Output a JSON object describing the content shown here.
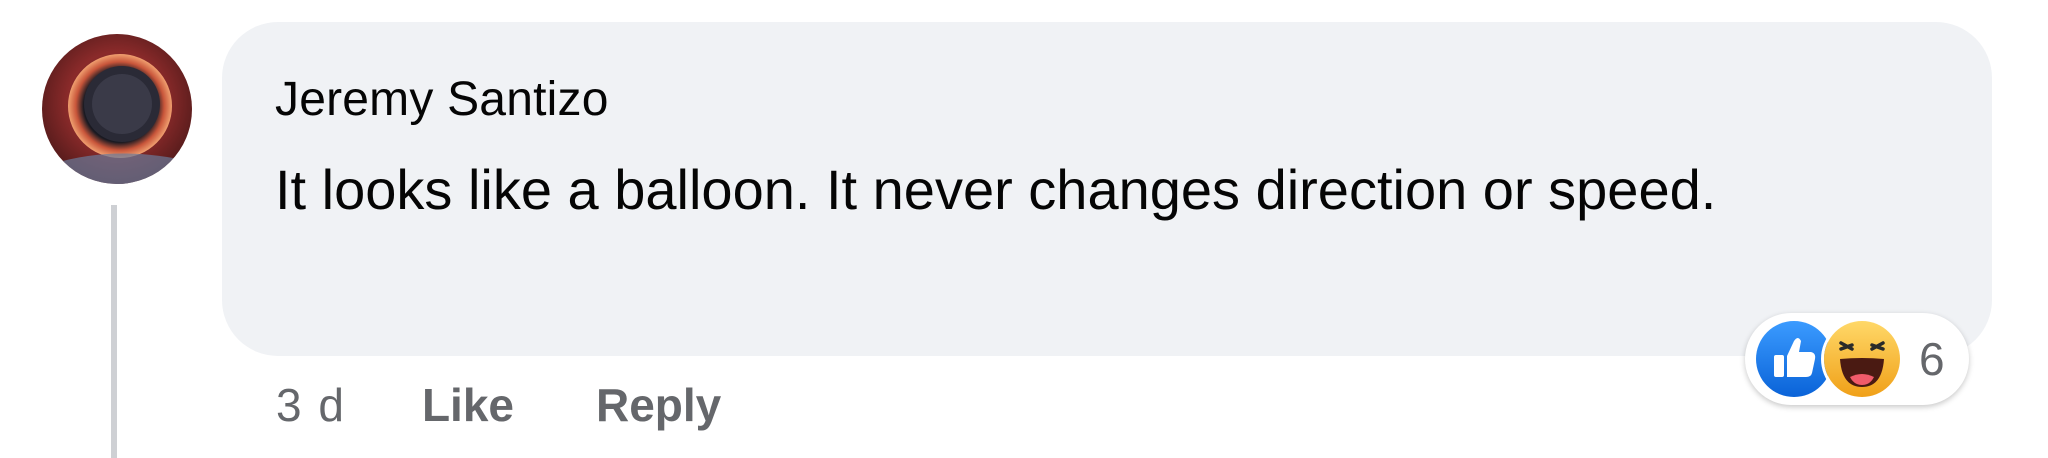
{
  "comment": {
    "author": "Jeremy Santizo",
    "text": "It looks like a balloon. It never changes direction or speed.",
    "time": "3 d",
    "like_label": "Like",
    "reply_label": "Reply"
  },
  "reactions": {
    "icons": [
      "like-icon",
      "haha-icon"
    ],
    "count": "6"
  },
  "colors": {
    "bubble": "#f0f2f5",
    "text": "#050505",
    "meta": "#65676b",
    "like_blue": "#1877f2",
    "haha_yellow": "#f7b125"
  }
}
